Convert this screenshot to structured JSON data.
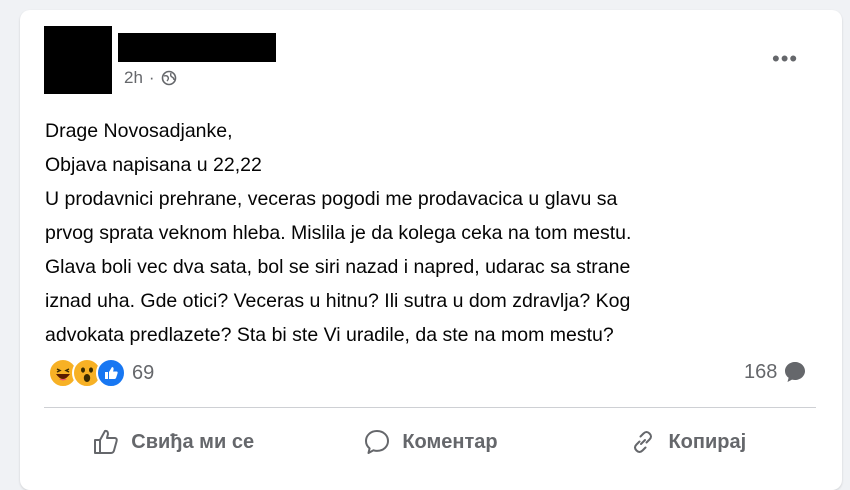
{
  "post": {
    "time": "2h",
    "privacy_icon": "globe-icon",
    "more_label": "•••",
    "lines": [
      "Drage Novosadjanke,",
      "Objava napisana u 22,22",
      "U prodavnici prehrane, veceras pogodi me prodavacica u glavu sa",
      "prvog sprata veknom hleba. Mislila je da kolega ceka na tom mestu.",
      "Glava boli vec dva sata, bol se siri nazad i napred, udarac sa strane",
      "iznad uha. Gde otici? Veceras u hitnu? Ili sutra u dom zdravlja? Kog",
      "advokata predlazete? Sta bi ste Vi uradile, da ste na mom mestu?"
    ]
  },
  "reactions": {
    "icons": [
      "haha-reaction-icon",
      "wow-reaction-icon",
      "like-reaction-icon"
    ],
    "count": "69"
  },
  "comments": {
    "count": "168",
    "icon": "comment-bubble-icon"
  },
  "actions": {
    "like_label": "Свиђа ми се",
    "comment_label": "Коментар",
    "copy_label": "Копирај"
  },
  "colors": {
    "like_blue": "#1877f2",
    "emoji_yellow": "#f7b125",
    "secondary_text": "#65676b"
  }
}
